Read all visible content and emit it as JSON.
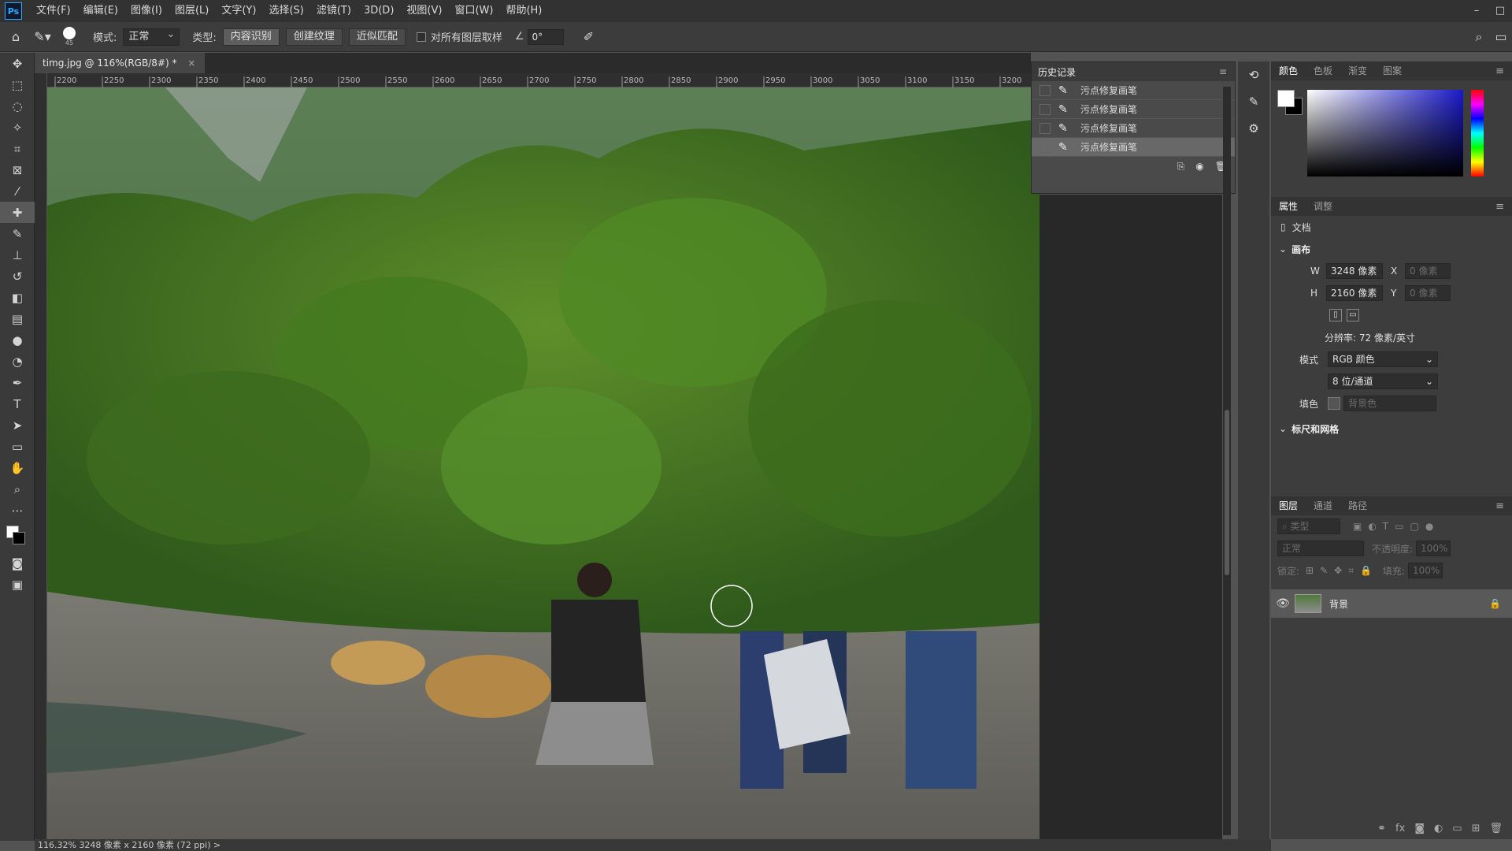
{
  "app": {
    "logo": "Ps",
    "menu": [
      "文件(F)",
      "编辑(E)",
      "图像(I)",
      "图层(L)",
      "文字(Y)",
      "选择(S)",
      "滤镜(T)",
      "3D(D)",
      "视图(V)",
      "窗口(W)",
      "帮助(H)"
    ],
    "window_controls": [
      "–",
      "□"
    ]
  },
  "options": {
    "brush_size": "45",
    "mode_label": "模式:",
    "mode_value": "正常",
    "type_label": "类型:",
    "type_buttons": [
      "内容识别",
      "创建纹理",
      "近似匹配"
    ],
    "sample_all_label": "对所有图层取样",
    "angle_value": "0°"
  },
  "document": {
    "tab_title": "timg.jpg @ 116%(RGB/8#) *",
    "close_glyph": "×",
    "ruler_ticks": [
      "2200",
      "2250",
      "2300",
      "2350",
      "2400",
      "2450",
      "2500",
      "2550",
      "2600",
      "2650",
      "2700",
      "2750",
      "2800",
      "2850",
      "2900",
      "2950",
      "3000",
      "3050",
      "3100",
      "3150",
      "3200"
    ]
  },
  "status": {
    "text": "116.32%  3248 像素 x 2160 像素 (72 ppi)   >"
  },
  "history": {
    "title": "历史记录",
    "items": [
      "污点修复画笔",
      "污点修复画笔",
      "污点修复画笔",
      "污点修复画笔"
    ],
    "selected_index": 3
  },
  "color_panel": {
    "tabs": [
      "颜色",
      "色板",
      "渐变",
      "图案"
    ],
    "foreground": "#ffffff",
    "background": "#000000"
  },
  "properties": {
    "tabs": [
      "属性",
      "调整"
    ],
    "doc_label": "文档",
    "canvas_section": "画布",
    "w_label": "W",
    "w_value": "3248 像素",
    "h_label": "H",
    "h_value": "2160 像素",
    "x_label": "X",
    "x_value": "0 像素",
    "y_label": "Y",
    "y_value": "0 像素",
    "resolution": "分辨率: 72 像素/英寸",
    "mode_label": "模式",
    "mode_value": "RGB 颜色",
    "depth_value": "8 位/通道",
    "fill_label": "填色",
    "fill_value": "背景色",
    "rulers_section": "标尺和网格"
  },
  "layers": {
    "tabs": [
      "图层",
      "通道",
      "路径"
    ],
    "search_placeholder": "类型",
    "blend_value": "正常",
    "opacity_label": "不透明度:",
    "opacity_value": "100%",
    "lock_label": "锁定:",
    "fill_label": "填充:",
    "fill_value": "100%",
    "layer_name": "背景"
  }
}
